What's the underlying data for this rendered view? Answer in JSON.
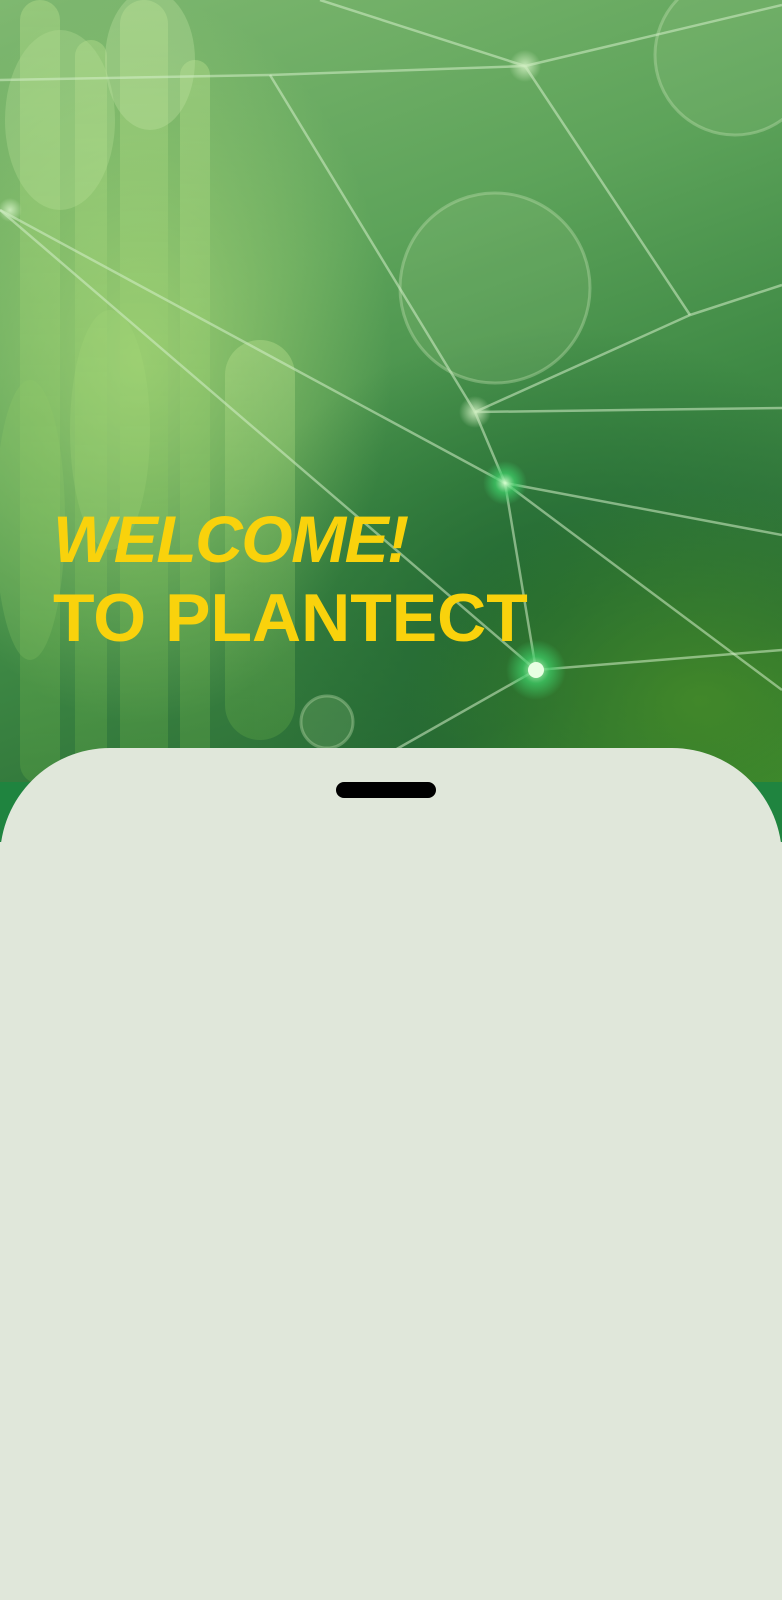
{
  "hero": {
    "welcome": "WELCOME!",
    "brand_line": "TO PLANTECT",
    "text_color": "#f9d20c",
    "background_theme": "green plant network illustration"
  },
  "sheet": {
    "background_color": "#e0e7da",
    "handle_color": "#000000"
  }
}
